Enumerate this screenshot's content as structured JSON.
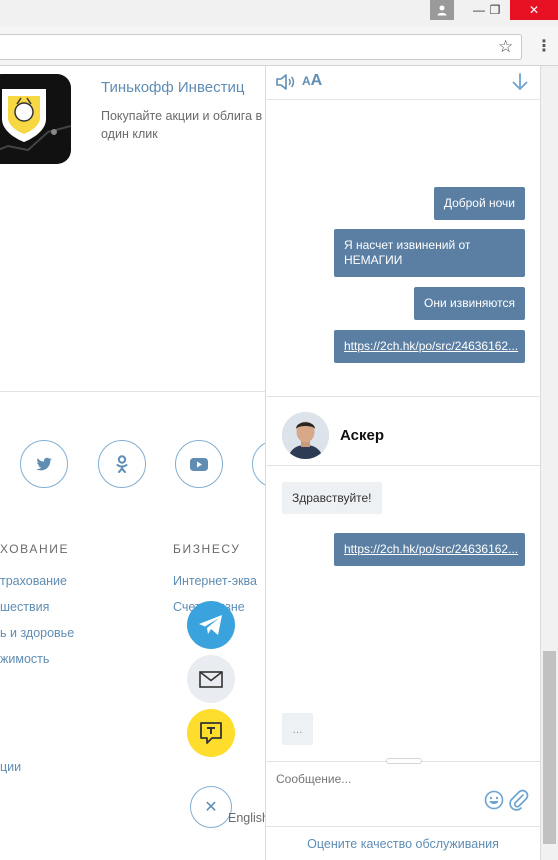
{
  "browser": {
    "user_icon": "user-icon",
    "minimize": "—",
    "restore": "❐",
    "close": "✕",
    "star": "☆",
    "menu": "⋮"
  },
  "page": {
    "app_title": "Тинькофф Инвестиц",
    "app_desc": "Покупайте акции и облига в один клик",
    "sections": {
      "left_head": "ХОВАНИЕ",
      "right_head": "БИЗНЕСУ",
      "left_links": [
        "трахование",
        "шествия",
        "ь и здоровье",
        "жимость"
      ],
      "right_links": [
        "Интернет-эква",
        "Счета бизне"
      ],
      "bottom_link": "ции"
    },
    "english": "English"
  },
  "chat": {
    "toolbar": {
      "sound_icon": "speaker-icon",
      "font_label": "AA",
      "scroll_icon": "arrow-down-icon"
    },
    "messages_out": [
      "Доброй ночи",
      "Я насчет извинений от НЕМАГИИ",
      "Они извиняются",
      "https://2ch.hk/po/src/24636162..."
    ],
    "operator_name": "Аскер",
    "message_in": "Здравствуйте!",
    "message_out_2": "https://2ch.hk/po/src/24636162...",
    "typing": "...",
    "input_placeholder": "Сообщение...",
    "rate_label": "Оцените качество обслуживания"
  },
  "colors": {
    "accent": "#5f8db4",
    "bubble": "#5b7fa3",
    "telegram": "#3aa2dc",
    "chat_yellow": "#fedd2c"
  }
}
